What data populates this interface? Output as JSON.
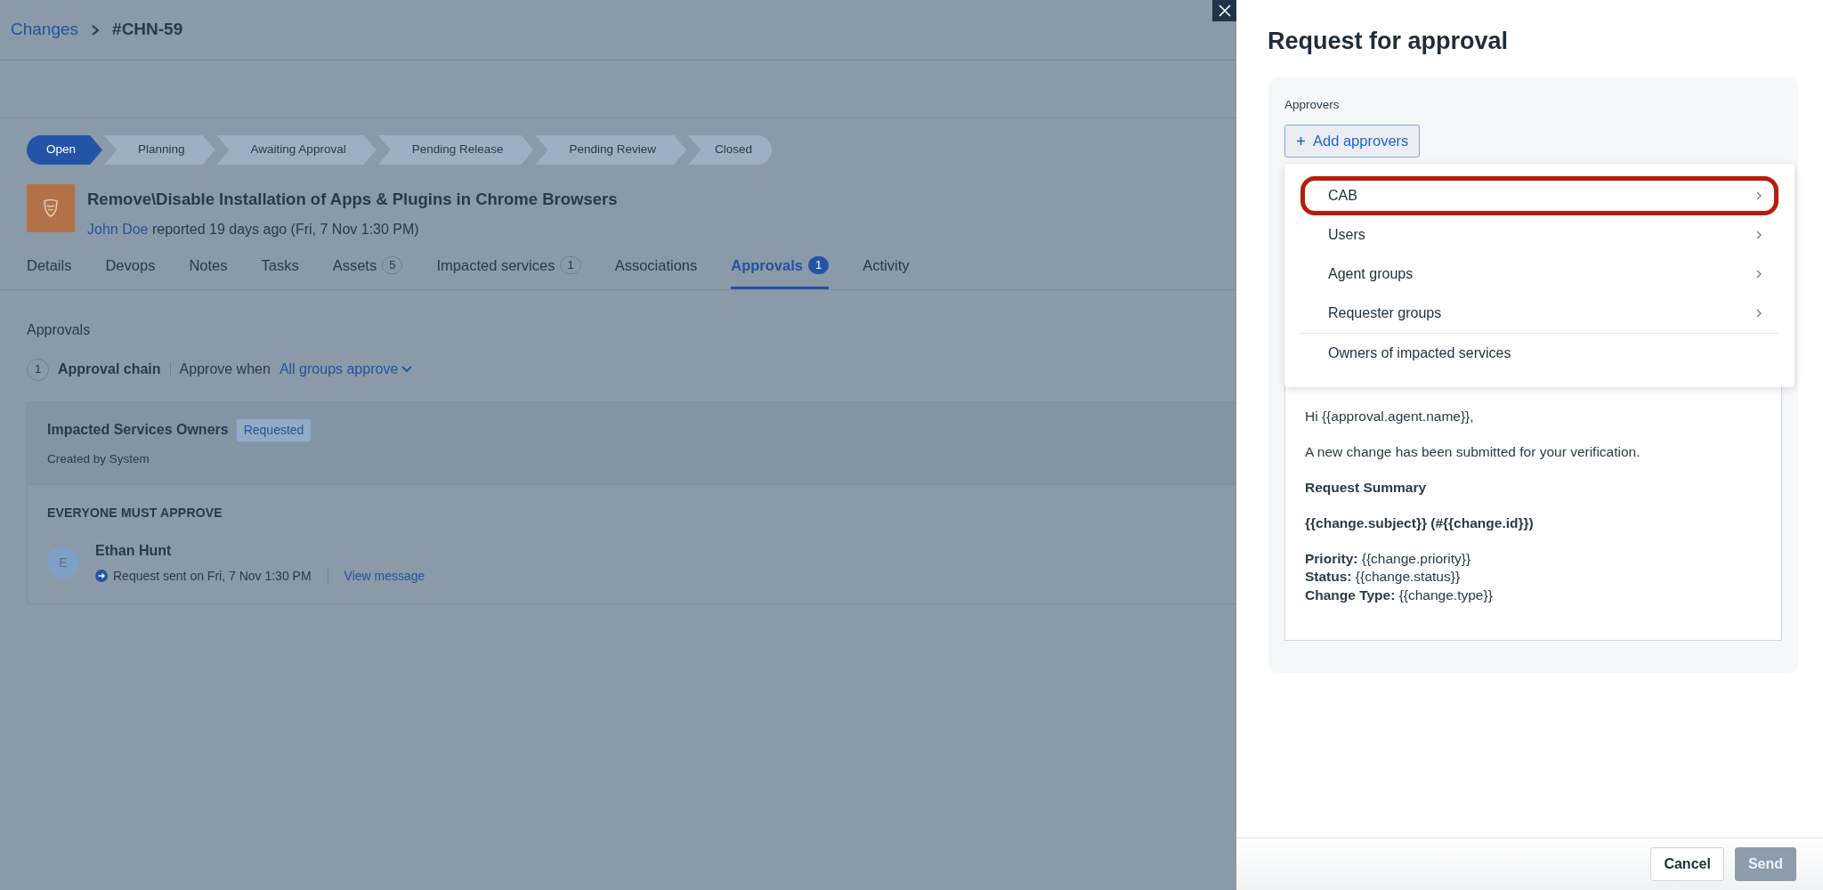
{
  "breadcrumb": {
    "parent": "Changes",
    "current": "#CHN-59"
  },
  "pipeline": [
    {
      "label": "Open",
      "selected": true
    },
    {
      "label": "Planning",
      "selected": false
    },
    {
      "label": "Awaiting Approval",
      "selected": false
    },
    {
      "label": "Pending Release",
      "selected": false
    },
    {
      "label": "Pending Review",
      "selected": false
    },
    {
      "label": "Closed",
      "selected": false
    }
  ],
  "change": {
    "title": "Remove\\Disable Installation of Apps & Plugins in Chrome Browsers",
    "reporter": "John Doe",
    "reported": "reported 19 days ago (Fri, 7 Nov 1:30 PM)"
  },
  "tabs": [
    {
      "label": "Details",
      "selected": false
    },
    {
      "label": "Devops",
      "selected": false
    },
    {
      "label": "Notes",
      "selected": false
    },
    {
      "label": "Tasks",
      "selected": false
    },
    {
      "label": "Assets",
      "count": "5",
      "selected": false
    },
    {
      "label": "Impacted services",
      "count": "1",
      "selected": false
    },
    {
      "label": "Associations",
      "selected": false
    },
    {
      "label": "Approvals",
      "count": "1",
      "selected": true
    },
    {
      "label": "Activity",
      "selected": false
    }
  ],
  "approvals": {
    "heading": "Approvals",
    "chain_number": "1",
    "chain_label": "Approval chain",
    "approve_when": "Approve when",
    "rule": "All groups approve",
    "group": {
      "name": "Impacted Services Owners",
      "status": "Requested",
      "created_by": "Created by System",
      "policy": "EVERYONE MUST APPROVE",
      "approvers": [
        {
          "initial": "E",
          "name": "Ethan Hunt",
          "sent": "Request sent on Fri, 7 Nov 1:30 PM",
          "link": "View message"
        }
      ]
    }
  },
  "panel": {
    "title": "Request for approval",
    "approvers_label": "Approvers",
    "add_button": "Add approvers",
    "menu": [
      {
        "label": "CAB",
        "submenu": true,
        "highlighted": true
      },
      {
        "label": "Users",
        "submenu": true,
        "highlighted": false
      },
      {
        "label": "Agent groups",
        "submenu": true,
        "highlighted": false
      },
      {
        "label": "Requester groups",
        "submenu": true,
        "highlighted": false
      },
      {
        "label": "Owners of impacted services",
        "submenu": false,
        "highlighted": false
      }
    ],
    "message": [
      {
        "kind": "text",
        "text": "Hi {{approval.agent.name}},"
      },
      {
        "kind": "text",
        "text": "A new change has been submitted for your verification."
      },
      {
        "kind": "bold",
        "text": "Request Summary"
      },
      {
        "kind": "bold",
        "text": "{{change.subject}} (#{{change.id}})"
      },
      {
        "kind": "fields",
        "lines": [
          "**Priority:** {{change.priority}}",
          "**Status:** {{change.status}}",
          "**Change Type:** {{change.type}}"
        ]
      }
    ]
  },
  "footer": {
    "buttons": [
      {
        "label": "Cancel",
        "kind": "secondary",
        "disabled": false
      },
      {
        "label": "Send",
        "kind": "primary",
        "disabled": true
      }
    ]
  }
}
